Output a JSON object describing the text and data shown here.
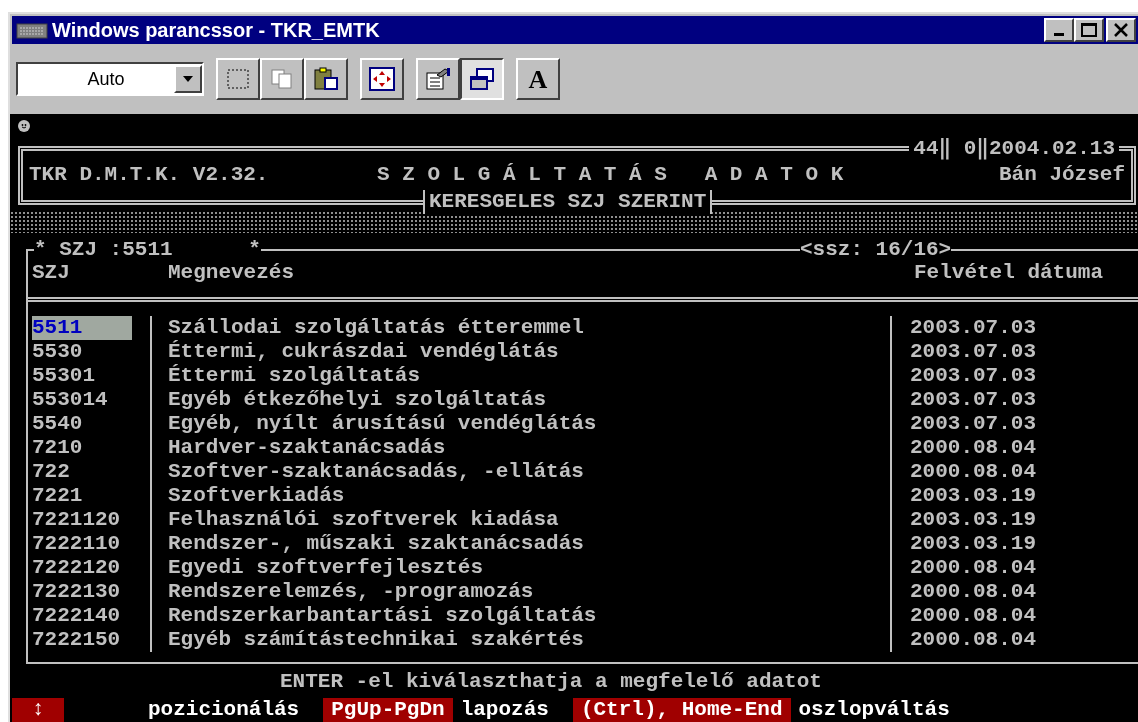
{
  "window": {
    "title": "Windows parancssor - TKR_EMTK"
  },
  "toolbar": {
    "font_size": "Auto",
    "buttons": [
      {
        "kind": "mark",
        "pressed": false
      },
      {
        "kind": "copy",
        "pressed": false
      },
      {
        "kind": "paste",
        "pressed": false
      },
      {
        "kind": "fullscreen",
        "pressed": false
      },
      {
        "kind": "properties",
        "pressed": false
      },
      {
        "kind": "background",
        "pressed": true
      },
      {
        "kind": "font",
        "label": "A",
        "pressed": false
      }
    ]
  },
  "console": {
    "header": {
      "program": "TKR D.M.T.K. V2.32.",
      "title": "S Z O L G Á L T A T Á S   A D A T O K",
      "subtitle": "KERESGELES SZJ SZERINT",
      "status": "44‖ 0‖2004.02.13",
      "user": "Bán József"
    },
    "list": {
      "filter": "* SZJ :5511      *",
      "position": "<ssz: 16/16>",
      "columns": [
        "SZJ",
        "Megnevezés",
        "Felvétel dátuma"
      ],
      "rows": [
        {
          "code": "5511",
          "name": "Szállodai szolgáltatás étteremmel",
          "date": "2003.07.03",
          "selected": true
        },
        {
          "code": "5530",
          "name": "Éttermi, cukrászdai vendéglátás",
          "date": "2003.07.03",
          "selected": false
        },
        {
          "code": "55301",
          "name": "Éttermi szolgáltatás",
          "date": "2003.07.03",
          "selected": false
        },
        {
          "code": "553014",
          "name": "Egyéb étkezőhelyi szolgáltatás",
          "date": "2003.07.03",
          "selected": false
        },
        {
          "code": "5540",
          "name": "Egyéb, nyílt árusítású vendéglátás",
          "date": "2003.07.03",
          "selected": false
        },
        {
          "code": "7210",
          "name": "Hardver-szaktanácsadás",
          "date": "2000.08.04",
          "selected": false
        },
        {
          "code": "722",
          "name": "Szoftver-szaktanácsadás, -ellátás",
          "date": "2000.08.04",
          "selected": false
        },
        {
          "code": "7221",
          "name": "Szoftverkiadás",
          "date": "2003.03.19",
          "selected": false
        },
        {
          "code": "7221120",
          "name": "Felhasználói szoftverek kiadása",
          "date": "2003.03.19",
          "selected": false
        },
        {
          "code": "7222110",
          "name": "Rendszer-, műszaki szaktanácsadás",
          "date": "2003.03.19",
          "selected": false
        },
        {
          "code": "7222120",
          "name": "Egyedi szoftverfejlesztés",
          "date": "2000.08.04",
          "selected": false
        },
        {
          "code": "7222130",
          "name": "Rendszerelemzés, -programozás",
          "date": "2000.08.04",
          "selected": false
        },
        {
          "code": "7222140",
          "name": "Rendszerkarbantartási szolgáltatás",
          "date": "2000.08.04",
          "selected": false
        },
        {
          "code": "7222150",
          "name": "Egyéb számítástechnikai szakértés",
          "date": "2000.08.04",
          "selected": false
        }
      ]
    },
    "footer": {
      "hint": "ENTER -el kiválaszthatja a megfelelő adatot",
      "keys": [
        {
          "key": "↕",
          "label": "pozicionálás"
        },
        {
          "key": "PgUp-PgDn",
          "label": "lapozás"
        },
        {
          "key": "(Ctrl), Home-End",
          "label": "oszlopváltás"
        }
      ]
    }
  }
}
